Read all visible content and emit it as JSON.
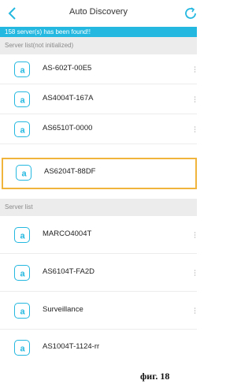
{
  "header": {
    "back_icon": "chevron-left-icon",
    "title": "Auto Discovery",
    "refresh_icon": "refresh-icon"
  },
  "banner": {
    "text": "158 server(s) has been found!!"
  },
  "sections": {
    "uninitialized_label": "Server list(not initialized)",
    "initialized_label": "Server list"
  },
  "servers_uninitialized": [
    {
      "name": "AS-602T-00E5"
    },
    {
      "name": "AS4004T-167A"
    },
    {
      "name": "AS6510T-0000"
    },
    {
      "name": "AS6204T-88DF",
      "selected": true
    }
  ],
  "servers_initialized": [
    {
      "name": "MARCO4004T"
    },
    {
      "name": "AS6104T-FA2D"
    },
    {
      "name": "Surveillance"
    },
    {
      "name": "AS1004T-1124-rr"
    }
  ],
  "caption": "фиг. 18",
  "colors": {
    "accent": "#24b8e0",
    "selection": "#f0b43c",
    "section_bg": "#ececec"
  }
}
